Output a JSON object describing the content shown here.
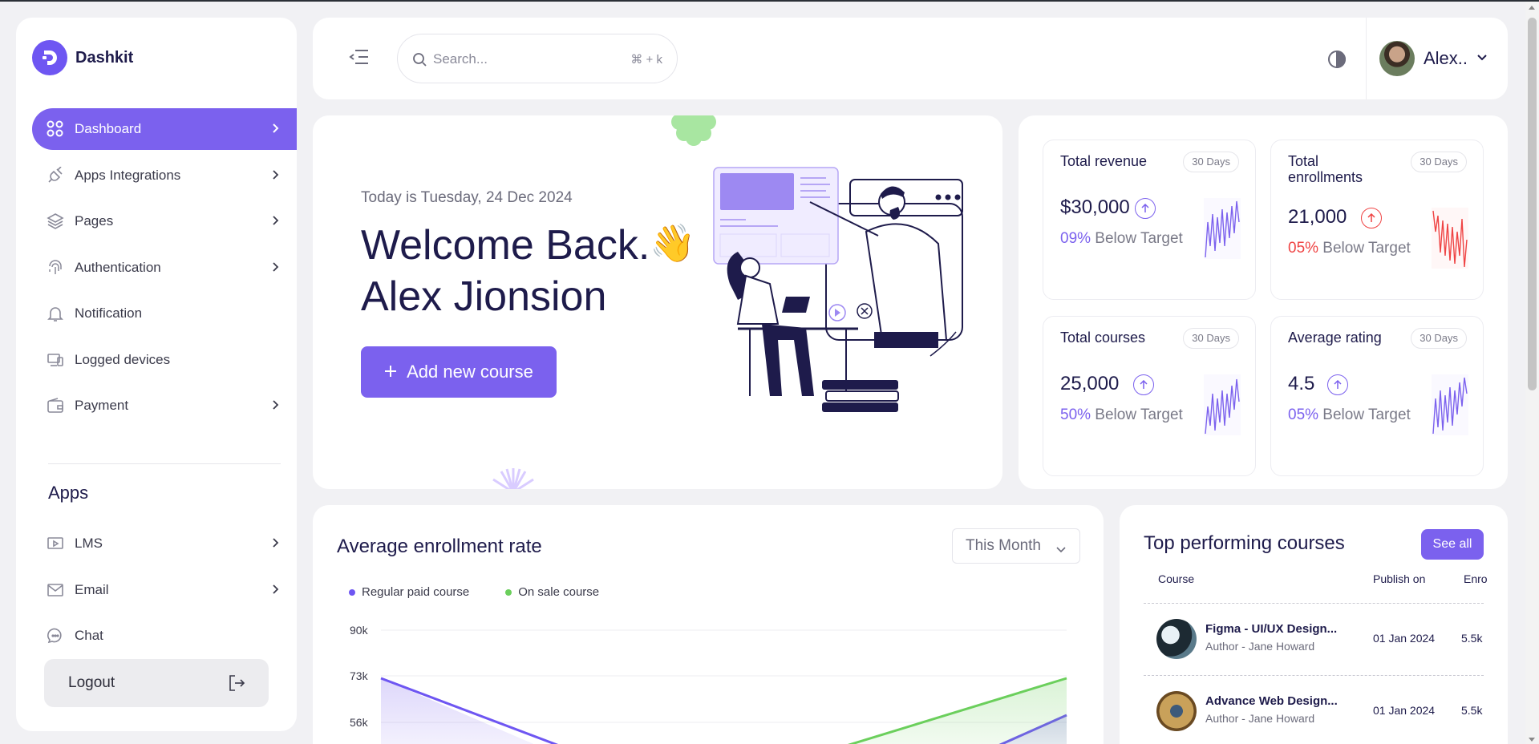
{
  "brand": {
    "name": "Dashkit"
  },
  "sidebar": {
    "items": [
      {
        "label": "Dashboard",
        "icon": "grid-icon",
        "active": true
      },
      {
        "label": "Apps Integrations",
        "icon": "plug-icon"
      },
      {
        "label": "Pages",
        "icon": "layers-icon"
      },
      {
        "label": "Authentication",
        "icon": "fingerprint-icon"
      },
      {
        "label": "Notification",
        "icon": "bell-icon"
      },
      {
        "label": "Logged devices",
        "icon": "devices-icon"
      },
      {
        "label": "Payment",
        "icon": "wallet-icon"
      }
    ],
    "apps_heading": "Apps",
    "apps": [
      {
        "label": "LMS",
        "icon": "video-icon"
      },
      {
        "label": "Email",
        "icon": "mail-icon"
      },
      {
        "label": "Chat",
        "icon": "chat-icon"
      }
    ],
    "logout_label": "Logout"
  },
  "topbar": {
    "search_placeholder": "Search...",
    "search_shortcut": "⌘ + k",
    "user_name": "Alex.."
  },
  "welcome": {
    "date": "Today is Tuesday, 24 Dec 2024",
    "title_line1": "Welcome Back.",
    "title_line2": "Alex Jionsion",
    "wave_emoji": "👋",
    "add_course_label": "Add new course"
  },
  "stats": [
    {
      "title": "Total revenue",
      "badge": "30 Days",
      "value": "$30,000",
      "percent": "09%",
      "sub": " Below Target",
      "trend": "up",
      "color": "#7b61ee"
    },
    {
      "title": "Total enrollments",
      "badge": "30 Days",
      "value": "21,000",
      "percent": "05%",
      "sub": " Below Target",
      "trend": "up",
      "color": "#ef4444"
    },
    {
      "title": "Total courses",
      "badge": "30 Days",
      "value": "25,000",
      "percent": "50%",
      "sub": " Below Target",
      "trend": "up",
      "color": "#7b61ee"
    },
    {
      "title": "Average rating",
      "badge": "30 Days",
      "value": "4.5",
      "percent": "05%",
      "sub": " Below Target",
      "trend": "up",
      "color": "#7b61ee"
    }
  ],
  "enrollment": {
    "title": "Average enrollment rate",
    "period": "This Month",
    "legend": [
      {
        "name": "Regular paid course",
        "color": "#6e56f2"
      },
      {
        "name": "On sale course",
        "color": "#6bcf5c"
      }
    ]
  },
  "chart_data": {
    "type": "area",
    "ylabels": [
      "90k",
      "73k",
      "56k"
    ],
    "series": [
      {
        "name": "Regular paid course",
        "color": "#6e56f2"
      },
      {
        "name": "On sale course",
        "color": "#6bcf5c"
      }
    ]
  },
  "courses": {
    "title": "Top performing courses",
    "see_all_label": "See all",
    "columns": [
      "Course",
      "Publish on",
      "Enro"
    ],
    "rows": [
      {
        "name": "Figma - UI/UX Design...",
        "author": "Author - Jane Howard",
        "date": "01 Jan 2024",
        "enrollments": "5.5k"
      },
      {
        "name": "Advance Web Design...",
        "author": "Author - Jane Howard",
        "date": "01 Jan 2024",
        "enrollments": "5.5k"
      }
    ]
  }
}
